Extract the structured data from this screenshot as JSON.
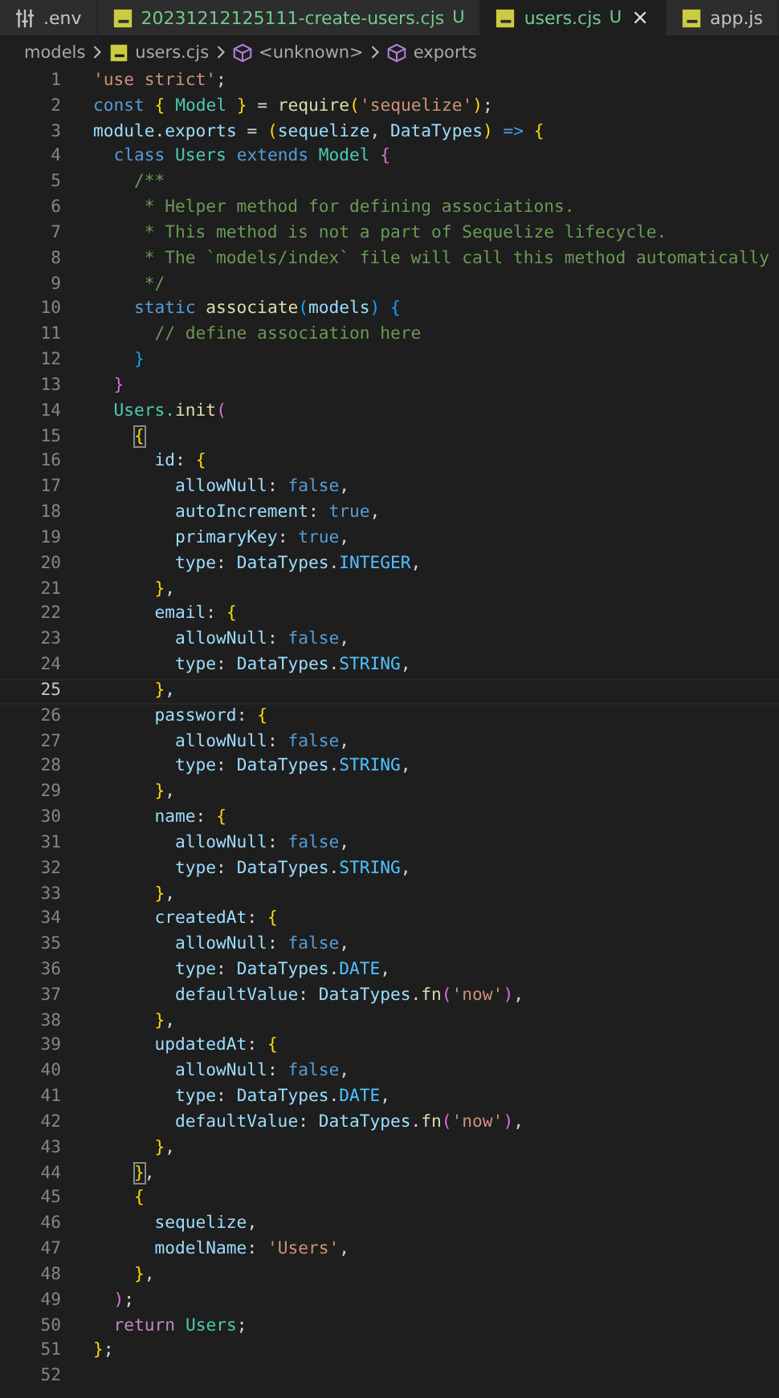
{
  "tabs": [
    {
      "kind": "env",
      "label": ".env",
      "untracked": false,
      "selected": false
    },
    {
      "kind": "js",
      "label": "20231212125111-create-users.cjs",
      "untracked": true,
      "badge": "U",
      "selected": false
    },
    {
      "kind": "js",
      "label": "users.cjs",
      "untracked": true,
      "badge": "U",
      "close": "×",
      "selected": true
    },
    {
      "kind": "js",
      "label": "app.js",
      "untracked": false,
      "selected": false
    }
  ],
  "breadcrumb": [
    {
      "kind": "folder",
      "label": "models"
    },
    {
      "kind": "file",
      "label": "users.cjs"
    },
    {
      "kind": "symbol",
      "label": "<unknown>"
    },
    {
      "kind": "symbol",
      "label": "exports"
    }
  ],
  "lines": [
    {
      "number": "1",
      "current": false,
      "tokens": [
        {
          "text": "'use strict'",
          "kind": "str"
        },
        {
          "text": ";",
          "kind": "p"
        }
      ]
    },
    {
      "number": "2",
      "current": false,
      "tokens": [
        {
          "text": "const ",
          "kind": "kw"
        },
        {
          "text": "{",
          "kind": "b1"
        },
        {
          "text": " Model ",
          "kind": "type"
        },
        {
          "text": "}",
          "kind": "b1"
        },
        {
          "text": " = ",
          "kind": "p"
        },
        {
          "text": "require",
          "kind": "fn"
        },
        {
          "text": "(",
          "kind": "b1"
        },
        {
          "text": "'sequelize'",
          "kind": "str"
        },
        {
          "text": ")",
          "kind": "b1"
        },
        {
          "text": ";",
          "kind": "p"
        }
      ]
    },
    {
      "number": "3",
      "current": false,
      "tokens": [
        {
          "text": "module",
          "kind": "var"
        },
        {
          "text": ".",
          "kind": "p"
        },
        {
          "text": "exports",
          "kind": "var"
        },
        {
          "text": " = ",
          "kind": "p"
        },
        {
          "text": "(",
          "kind": "b1"
        },
        {
          "text": "sequelize",
          "kind": "var"
        },
        {
          "text": ", ",
          "kind": "p"
        },
        {
          "text": "DataTypes",
          "kind": "var"
        },
        {
          "text": ")",
          "kind": "b1"
        },
        {
          "text": " => ",
          "kind": "kw"
        },
        {
          "text": "{",
          "kind": "b1"
        }
      ]
    },
    {
      "number": "4",
      "current": false,
      "tokens": [
        {
          "text": "  class",
          "kind": "kw"
        },
        {
          "text": " Users ",
          "kind": "type"
        },
        {
          "text": "extends",
          "kind": "kw"
        },
        {
          "text": " Model ",
          "kind": "type"
        },
        {
          "text": "{",
          "kind": "b2"
        }
      ]
    },
    {
      "number": "5",
      "current": false,
      "tokens": [
        {
          "text": "    /**",
          "kind": "com"
        }
      ]
    },
    {
      "number": "6",
      "current": false,
      "tokens": [
        {
          "text": "     * Helper method for defining associations.",
          "kind": "com"
        }
      ]
    },
    {
      "number": "7",
      "current": false,
      "tokens": [
        {
          "text": "     * This method is not a part of Sequelize lifecycle.",
          "kind": "com"
        }
      ]
    },
    {
      "number": "8",
      "current": false,
      "tokens": [
        {
          "text": "     * The `models/index` file will call this method automatically",
          "kind": "com"
        }
      ]
    },
    {
      "number": "9",
      "current": false,
      "tokens": [
        {
          "text": "     */",
          "kind": "com"
        }
      ]
    },
    {
      "number": "10",
      "current": false,
      "tokens": [
        {
          "text": "    static ",
          "kind": "kw"
        },
        {
          "text": "associate",
          "kind": "fn"
        },
        {
          "text": "(",
          "kind": "b3"
        },
        {
          "text": "models",
          "kind": "var"
        },
        {
          "text": ")",
          "kind": "b3"
        },
        {
          "text": " {",
          "kind": "b3"
        }
      ]
    },
    {
      "number": "11",
      "current": false,
      "tokens": [
        {
          "text": "      // define association here",
          "kind": "com"
        }
      ]
    },
    {
      "number": "12",
      "current": false,
      "tokens": [
        {
          "text": "    }",
          "kind": "b3"
        }
      ]
    },
    {
      "number": "13",
      "current": false,
      "tokens": [
        {
          "text": "  }",
          "kind": "b2"
        }
      ]
    },
    {
      "number": "14",
      "current": false,
      "tokens": [
        {
          "text": "  Users.",
          "kind": "type"
        },
        {
          "text": "init",
          "kind": "fn"
        },
        {
          "text": "(",
          "kind": "b2"
        }
      ]
    },
    {
      "number": "15",
      "current": false,
      "tokens": [
        {
          "text": "    {",
          "kind": "bm"
        }
      ]
    },
    {
      "number": "16",
      "current": false,
      "tokens": [
        {
          "text": "      id",
          "kind": "var"
        },
        {
          "text": ": ",
          "kind": "p"
        },
        {
          "text": "{",
          "kind": "b1"
        }
      ]
    },
    {
      "number": "17",
      "current": false,
      "tokens": [
        {
          "text": "        allowNull",
          "kind": "var"
        },
        {
          "text": ": ",
          "kind": "p"
        },
        {
          "text": "false",
          "kind": "kw"
        },
        {
          "text": ",",
          "kind": "p"
        }
      ]
    },
    {
      "number": "18",
      "current": false,
      "tokens": [
        {
          "text": "        autoIncrement",
          "kind": "var"
        },
        {
          "text": ": ",
          "kind": "p"
        },
        {
          "text": "true",
          "kind": "kw"
        },
        {
          "text": ",",
          "kind": "p"
        }
      ]
    },
    {
      "number": "19",
      "current": false,
      "tokens": [
        {
          "text": "        primaryKey",
          "kind": "var"
        },
        {
          "text": ": ",
          "kind": "p"
        },
        {
          "text": "true",
          "kind": "kw"
        },
        {
          "text": ",",
          "kind": "p"
        }
      ]
    },
    {
      "number": "20",
      "current": false,
      "tokens": [
        {
          "text": "        type",
          "kind": "var"
        },
        {
          "text": ": ",
          "kind": "p"
        },
        {
          "text": "DataTypes",
          "kind": "var"
        },
        {
          "text": ".",
          "kind": "p"
        },
        {
          "text": "INTEGER",
          "kind": "const"
        },
        {
          "text": ",",
          "kind": "p"
        }
      ]
    },
    {
      "number": "21",
      "current": false,
      "tokens": [
        {
          "text": "      }",
          "kind": "b1"
        },
        {
          "text": ",",
          "kind": "p"
        }
      ]
    },
    {
      "number": "22",
      "current": false,
      "tokens": [
        {
          "text": "      email",
          "kind": "var"
        },
        {
          "text": ": ",
          "kind": "p"
        },
        {
          "text": "{",
          "kind": "b1"
        }
      ]
    },
    {
      "number": "23",
      "current": false,
      "tokens": [
        {
          "text": "        allowNull",
          "kind": "var"
        },
        {
          "text": ": ",
          "kind": "p"
        },
        {
          "text": "false",
          "kind": "kw"
        },
        {
          "text": ",",
          "kind": "p"
        }
      ]
    },
    {
      "number": "24",
      "current": false,
      "tokens": [
        {
          "text": "        type",
          "kind": "var"
        },
        {
          "text": ": ",
          "kind": "p"
        },
        {
          "text": "DataTypes",
          "kind": "var"
        },
        {
          "text": ".",
          "kind": "p"
        },
        {
          "text": "STRING",
          "kind": "const"
        },
        {
          "text": ",",
          "kind": "p"
        }
      ]
    },
    {
      "number": "25",
      "current": true,
      "tokens": [
        {
          "text": "      }",
          "kind": "b1"
        },
        {
          "text": ",",
          "kind": "p"
        }
      ]
    },
    {
      "number": "26",
      "current": false,
      "tokens": [
        {
          "text": "      password",
          "kind": "var"
        },
        {
          "text": ": ",
          "kind": "p"
        },
        {
          "text": "{",
          "kind": "b1"
        }
      ]
    },
    {
      "number": "27",
      "current": false,
      "tokens": [
        {
          "text": "        allowNull",
          "kind": "var"
        },
        {
          "text": ": ",
          "kind": "p"
        },
        {
          "text": "false",
          "kind": "kw"
        },
        {
          "text": ",",
          "kind": "p"
        }
      ]
    },
    {
      "number": "28",
      "current": false,
      "tokens": [
        {
          "text": "        type",
          "kind": "var"
        },
        {
          "text": ": ",
          "kind": "p"
        },
        {
          "text": "DataTypes",
          "kind": "var"
        },
        {
          "text": ".",
          "kind": "p"
        },
        {
          "text": "STRING",
          "kind": "const"
        },
        {
          "text": ",",
          "kind": "p"
        }
      ]
    },
    {
      "number": "29",
      "current": false,
      "tokens": [
        {
          "text": "      }",
          "kind": "b1"
        },
        {
          "text": ",",
          "kind": "p"
        }
      ]
    },
    {
      "number": "30",
      "current": false,
      "tokens": [
        {
          "text": "      name",
          "kind": "var"
        },
        {
          "text": ": ",
          "kind": "p"
        },
        {
          "text": "{",
          "kind": "b1"
        }
      ]
    },
    {
      "number": "31",
      "current": false,
      "tokens": [
        {
          "text": "        allowNull",
          "kind": "var"
        },
        {
          "text": ": ",
          "kind": "p"
        },
        {
          "text": "false",
          "kind": "kw"
        },
        {
          "text": ",",
          "kind": "p"
        }
      ]
    },
    {
      "number": "32",
      "current": false,
      "tokens": [
        {
          "text": "        type",
          "kind": "var"
        },
        {
          "text": ": ",
          "kind": "p"
        },
        {
          "text": "DataTypes",
          "kind": "var"
        },
        {
          "text": ".",
          "kind": "p"
        },
        {
          "text": "STRING",
          "kind": "const"
        },
        {
          "text": ",",
          "kind": "p"
        }
      ]
    },
    {
      "number": "33",
      "current": false,
      "tokens": [
        {
          "text": "      }",
          "kind": "b1"
        },
        {
          "text": ",",
          "kind": "p"
        }
      ]
    },
    {
      "number": "34",
      "current": false,
      "tokens": [
        {
          "text": "      createdAt",
          "kind": "var"
        },
        {
          "text": ": ",
          "kind": "p"
        },
        {
          "text": "{",
          "kind": "b1"
        }
      ]
    },
    {
      "number": "35",
      "current": false,
      "tokens": [
        {
          "text": "        allowNull",
          "kind": "var"
        },
        {
          "text": ": ",
          "kind": "p"
        },
        {
          "text": "false",
          "kind": "kw"
        },
        {
          "text": ",",
          "kind": "p"
        }
      ]
    },
    {
      "number": "36",
      "current": false,
      "tokens": [
        {
          "text": "        type",
          "kind": "var"
        },
        {
          "text": ": ",
          "kind": "p"
        },
        {
          "text": "DataTypes",
          "kind": "var"
        },
        {
          "text": ".",
          "kind": "p"
        },
        {
          "text": "DATE",
          "kind": "const"
        },
        {
          "text": ",",
          "kind": "p"
        }
      ]
    },
    {
      "number": "37",
      "current": false,
      "tokens": [
        {
          "text": "        defaultValue",
          "kind": "var"
        },
        {
          "text": ": ",
          "kind": "p"
        },
        {
          "text": "DataTypes",
          "kind": "var"
        },
        {
          "text": ".",
          "kind": "p"
        },
        {
          "text": "fn",
          "kind": "fn"
        },
        {
          "text": "(",
          "kind": "b2"
        },
        {
          "text": "'now'",
          "kind": "str"
        },
        {
          "text": ")",
          "kind": "b2"
        },
        {
          "text": ",",
          "kind": "p"
        }
      ]
    },
    {
      "number": "38",
      "current": false,
      "tokens": [
        {
          "text": "      }",
          "kind": "b1"
        },
        {
          "text": ",",
          "kind": "p"
        }
      ]
    },
    {
      "number": "39",
      "current": false,
      "tokens": [
        {
          "text": "      updatedAt",
          "kind": "var"
        },
        {
          "text": ": ",
          "kind": "p"
        },
        {
          "text": "{",
          "kind": "b1"
        }
      ]
    },
    {
      "number": "40",
      "current": false,
      "tokens": [
        {
          "text": "        allowNull",
          "kind": "var"
        },
        {
          "text": ": ",
          "kind": "p"
        },
        {
          "text": "false",
          "kind": "kw"
        },
        {
          "text": ",",
          "kind": "p"
        }
      ]
    },
    {
      "number": "41",
      "current": false,
      "tokens": [
        {
          "text": "        type",
          "kind": "var"
        },
        {
          "text": ": ",
          "kind": "p"
        },
        {
          "text": "DataTypes",
          "kind": "var"
        },
        {
          "text": ".",
          "kind": "p"
        },
        {
          "text": "DATE",
          "kind": "const"
        },
        {
          "text": ",",
          "kind": "p"
        }
      ]
    },
    {
      "number": "42",
      "current": false,
      "tokens": [
        {
          "text": "        defaultValue",
          "kind": "var"
        },
        {
          "text": ": ",
          "kind": "p"
        },
        {
          "text": "DataTypes",
          "kind": "var"
        },
        {
          "text": ".",
          "kind": "p"
        },
        {
          "text": "fn",
          "kind": "fn"
        },
        {
          "text": "(",
          "kind": "b2"
        },
        {
          "text": "'now'",
          "kind": "str"
        },
        {
          "text": ")",
          "kind": "b2"
        },
        {
          "text": ",",
          "kind": "p"
        }
      ]
    },
    {
      "number": "43",
      "current": false,
      "tokens": [
        {
          "text": "      }",
          "kind": "b1"
        },
        {
          "text": ",",
          "kind": "p"
        }
      ]
    },
    {
      "number": "44",
      "current": false,
      "tokens": [
        {
          "text": "    }",
          "kind": "bm"
        },
        {
          "text": ",",
          "kind": "p"
        }
      ]
    },
    {
      "number": "45",
      "current": false,
      "tokens": [
        {
          "text": "    {",
          "kind": "b1"
        }
      ]
    },
    {
      "number": "46",
      "current": false,
      "tokens": [
        {
          "text": "      sequelize",
          "kind": "var"
        },
        {
          "text": ",",
          "kind": "p"
        }
      ]
    },
    {
      "number": "47",
      "current": false,
      "tokens": [
        {
          "text": "      modelName",
          "kind": "var"
        },
        {
          "text": ": ",
          "kind": "p"
        },
        {
          "text": "'Users'",
          "kind": "str"
        },
        {
          "text": ",",
          "kind": "p"
        }
      ]
    },
    {
      "number": "48",
      "current": false,
      "tokens": [
        {
          "text": "    }",
          "kind": "b1"
        },
        {
          "text": ",",
          "kind": "p"
        }
      ]
    },
    {
      "number": "49",
      "current": false,
      "tokens": [
        {
          "text": "  )",
          "kind": "b2"
        },
        {
          "text": ";",
          "kind": "p"
        }
      ]
    },
    {
      "number": "50",
      "current": false,
      "tokens": [
        {
          "text": "  return",
          "kind": "ctl"
        },
        {
          "text": " Users",
          "kind": "type"
        },
        {
          "text": ";",
          "kind": "p"
        }
      ]
    },
    {
      "number": "51",
      "current": false,
      "tokens": [
        {
          "text": "}",
          "kind": "b1"
        },
        {
          "text": ";",
          "kind": "p"
        }
      ]
    },
    {
      "number": "52",
      "current": false
    }
  ]
}
